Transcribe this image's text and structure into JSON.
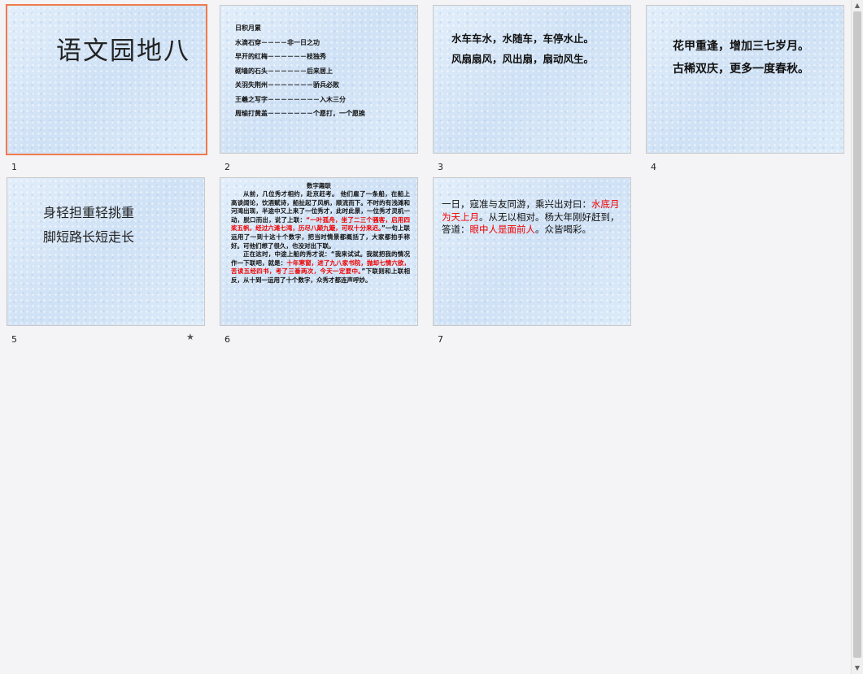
{
  "slides": [
    {
      "number": "1",
      "title": "语文园地八"
    },
    {
      "number": "2",
      "lines": [
        "日积月累",
        "水滴石穿－－－－非一日之功",
        "早开的红梅－－－－－－枝独秀",
        "砌墙的石头－－－－－－后来居上",
        "关羽失荆州－－－－－－－骄兵必败",
        "王羲之写字－－－－－－－－入木三分",
        "周瑜打黄盖－－－－－－－个愿打，一个愿挨"
      ]
    },
    {
      "number": "3",
      "lines": [
        "水车车水，水随车，车停水止。",
        "风扇扇风，风出扇，扇动风生。"
      ]
    },
    {
      "number": "4",
      "lines": [
        "花甲重逢，增加三七岁月。",
        "古稀双庆，更多一度春秋。"
      ]
    },
    {
      "number": "5",
      "lines": [
        "身轻担重轻挑重",
        "脚短路长短走长"
      ],
      "anim_icon": "star-icon"
    },
    {
      "number": "6",
      "title": "数字趣联",
      "p1_a": "从前，几位秀才相约，赴京赶考。 他们雇了一条船，在船上高谈阔论，饮酒赋诗，船扯起了风帆，顺流而下。不时的有浅滩和河湾出现，半途中又上来了一位秀才，此时此景，一位秀才灵机一动，脱口而出，说了上联：",
      "p1_red": "“一叶孤舟，坐了二三个骚客，启用四桨五帆，经过六滩七湾，历尽八颠九簸，可叹十分来迟。",
      "p1_b": "”一句上联运用了一到十这十个数字，把当时情景都概括了，大家都拍手称好。可他们想了很久，也没对出下联。",
      "p2_a": "正在这时，中途上船的秀才说：“我来试试。我就把我的情况作一下联吧，就是：",
      "p2_red": "十年寒窗，进了九八家书院，抛却七情六欲，苦读五经四书，考了三番两次，今天一定要中。",
      "p2_b": "”下联则和上联相反，从十到一运用了十个数字，众秀才都连声呼妙。"
    },
    {
      "number": "7",
      "t1": "一日，寇准与友同游，乘兴出对曰：",
      "r1": "水底月为天上月",
      "t2": "。从无以相对。杨大年刚好赶到，答道：",
      "r2": "眼中人是面前人",
      "t3": "。众皆喝彩。"
    }
  ],
  "anim_glyph": "★",
  "colors": {
    "selected_border": "#f07a4c",
    "highlight_text": "#e00000"
  }
}
